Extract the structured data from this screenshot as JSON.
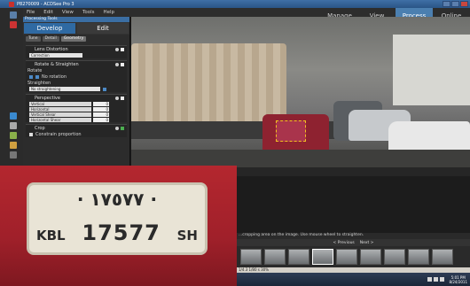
{
  "window": {
    "title": "P8270009 - ACDSee Pro 3"
  },
  "menu": {
    "items": [
      "File",
      "Edit",
      "View",
      "Tools",
      "Help"
    ]
  },
  "modes": {
    "items": [
      "Manage",
      "View",
      "Process",
      "Online"
    ],
    "active": "Process"
  },
  "panel": {
    "header": "Processing Tools",
    "tabs": {
      "develop": "Develop",
      "edit": "Edit"
    },
    "subtabs": [
      "Tune",
      "Detail",
      "Geometry"
    ],
    "lens": {
      "title": "Lens Distortion",
      "dropdown": "Correction"
    },
    "rotate": {
      "title": "Rotate & Straighten",
      "rotate_label": "Rotate",
      "no_rotation": "No rotation",
      "straighten_label": "Straighten",
      "straighten_dropdown": "No straightening"
    },
    "perspective": {
      "title": "Perspective",
      "sliders": [
        {
          "label": "Vertical",
          "value": "0"
        },
        {
          "label": "Horizontal",
          "value": "0"
        },
        {
          "label": "Vertical Shear",
          "value": "0"
        },
        {
          "label": "Horizontal Shear",
          "value": "0"
        }
      ]
    },
    "crop": {
      "title": "Crop",
      "constrain": "Constrain proportion"
    }
  },
  "viewer": {
    "hint": "...cropping area on the image. Use mouse wheel to straighten."
  },
  "filmstrip": {
    "prev": "< Previous",
    "next": "Next >",
    "thumb_count": 9,
    "selected_index": 3
  },
  "status": {
    "text": "1/4.3   1/80 s   30%"
  },
  "clock": {
    "time": "5:01 PM",
    "date": "8/24/2011"
  },
  "plate": {
    "top": "· ١٧٥٧٧ ·",
    "code": "KBL",
    "number": "17577",
    "suffix": "SH"
  }
}
